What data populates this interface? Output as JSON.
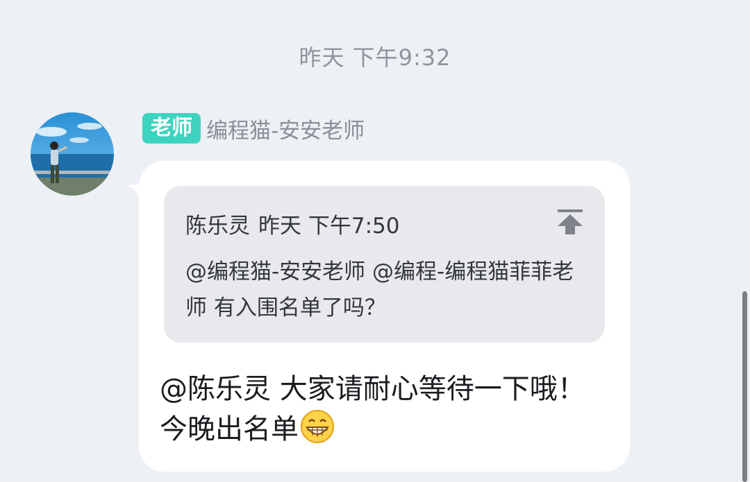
{
  "chat": {
    "timestamp": "昨天 下午9:32",
    "message": {
      "role_badge": "老师",
      "sender_name": "编程猫-安安老师",
      "quote": {
        "author": "陈乐灵",
        "time": "昨天 下午7:50",
        "text": "@编程猫-安安老师 @编程-编程猫菲菲老师 有入围名单了吗？"
      },
      "reply_text": "@陈乐灵 大家请耐心等待一下哦！今晚出名单",
      "emoji": "grinning-face-emoji"
    }
  },
  "colors": {
    "background": "#edf0f5",
    "badge": "#3ed3c0",
    "bubble": "#ffffff",
    "quote_card": "#e8e9ed"
  },
  "icons": {
    "pin": "pin-to-top-icon"
  }
}
